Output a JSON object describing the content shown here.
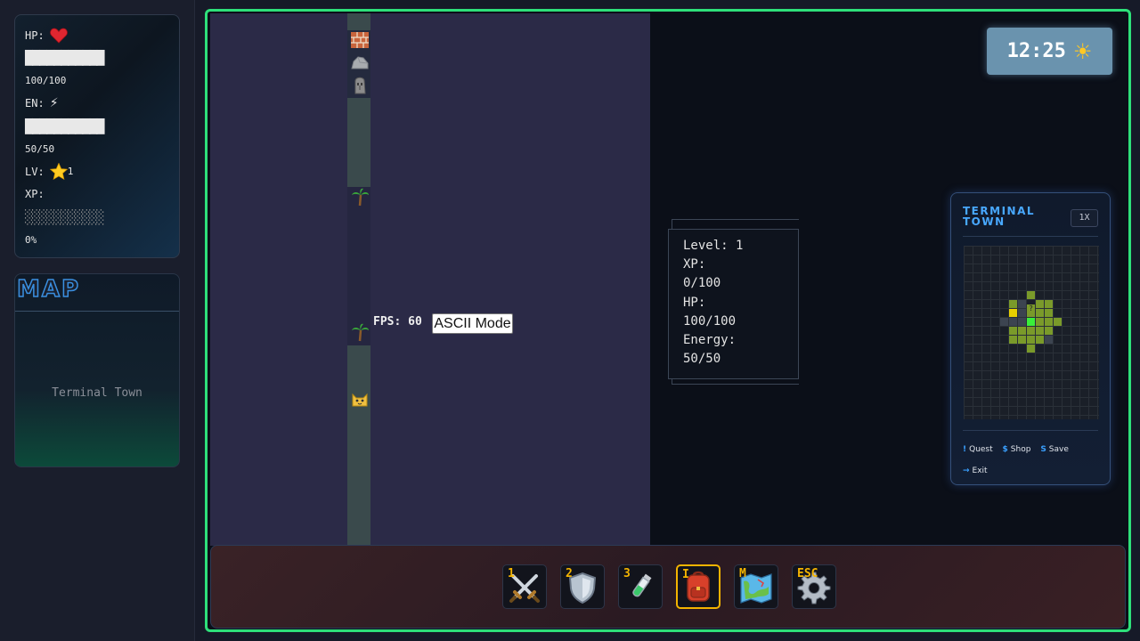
{
  "stats": {
    "hp_label": "HP:",
    "hp_icon": "heart",
    "hp_bar": "███████████",
    "hp_value": "100/100",
    "en_label": "EN:",
    "en_icon": "lightning",
    "en_bar": "███████████",
    "en_value": "50/50",
    "lv_label": "LV:",
    "lv_icon": "star",
    "lv_value": "1",
    "xp_label": "XP:",
    "xp_bar": "░░░░░░░░░░░",
    "xp_value": "0%"
  },
  "map_panel": {
    "title": "MAP",
    "location": "Terminal Town"
  },
  "hud": {
    "fps": "FPS: 60",
    "ascii_button": "ASCII Mode"
  },
  "info_box": {
    "lines": [
      "Level: 1",
      "XP:",
      "0/100",
      "HP:",
      "100/100",
      "Energy:",
      "50/50"
    ]
  },
  "clock": {
    "time": "12:25",
    "weather_icon": "sun"
  },
  "minimap": {
    "title_line1": "TERMINAL",
    "title_line2": "TOWN",
    "zoom": "1X",
    "unknown_marker": "?",
    "legend": [
      {
        "symbol": "!",
        "label": "Quest"
      },
      {
        "symbol": "$",
        "label": "Shop"
      },
      {
        "symbol": "S",
        "label": "Save"
      },
      {
        "symbol": "→",
        "label": "Exit"
      }
    ]
  },
  "world_tiles": [
    {
      "name": "brick-wall-tile",
      "icon": "brick"
    },
    {
      "name": "rock-tile",
      "icon": "rock"
    },
    {
      "name": "statue-tile",
      "icon": "moai"
    },
    {
      "name": "palm-tree-tile-1",
      "icon": "palm"
    },
    {
      "name": "palm-tree-tile-2",
      "icon": "palm"
    },
    {
      "name": "cat-npc-tile",
      "icon": "cat"
    }
  ],
  "hotbar": [
    {
      "key": "1",
      "icon": "sword"
    },
    {
      "key": "2",
      "icon": "shield"
    },
    {
      "key": "3",
      "icon": "potion"
    },
    {
      "key": "I",
      "icon": "backpack",
      "active": true
    },
    {
      "key": "M",
      "icon": "map"
    },
    {
      "key": "ESC",
      "icon": "gear"
    }
  ],
  "colors": {
    "frame_border": "#2ee07a",
    "world_bg": "#2b2a47",
    "active_slot": "#f4b400",
    "minimap_accent": "#48a8ff",
    "minimap_grass": "#7a9a2a",
    "minimap_player": "#3aef3a",
    "minimap_marker": "#e8d000"
  }
}
